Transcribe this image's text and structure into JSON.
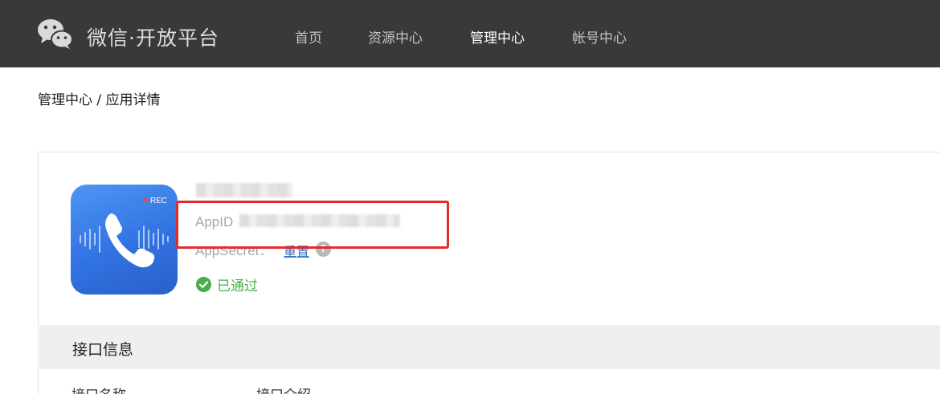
{
  "header": {
    "brand": "微信·开放平台",
    "nav": [
      {
        "label": "首页",
        "active": false
      },
      {
        "label": "资源中心",
        "active": false
      },
      {
        "label": "管理中心",
        "active": true
      },
      {
        "label": "帐号中心",
        "active": false
      }
    ]
  },
  "breadcrumb": {
    "parent": "管理中心",
    "separator": " / ",
    "current": "应用详情"
  },
  "app": {
    "icon_badge": "REC",
    "appid_label": "AppID",
    "secret_label": "AppSecret：",
    "reset_label": "重置",
    "help_icon": "?",
    "status": "已通过"
  },
  "interface_section": {
    "title": "接口信息",
    "columns": [
      "接口名称",
      "接口介绍"
    ]
  },
  "colors": {
    "header_bg": "#393939",
    "status_green": "#4aae4b",
    "link_blue": "#3a75c4",
    "highlight_red": "#e32b2b"
  }
}
